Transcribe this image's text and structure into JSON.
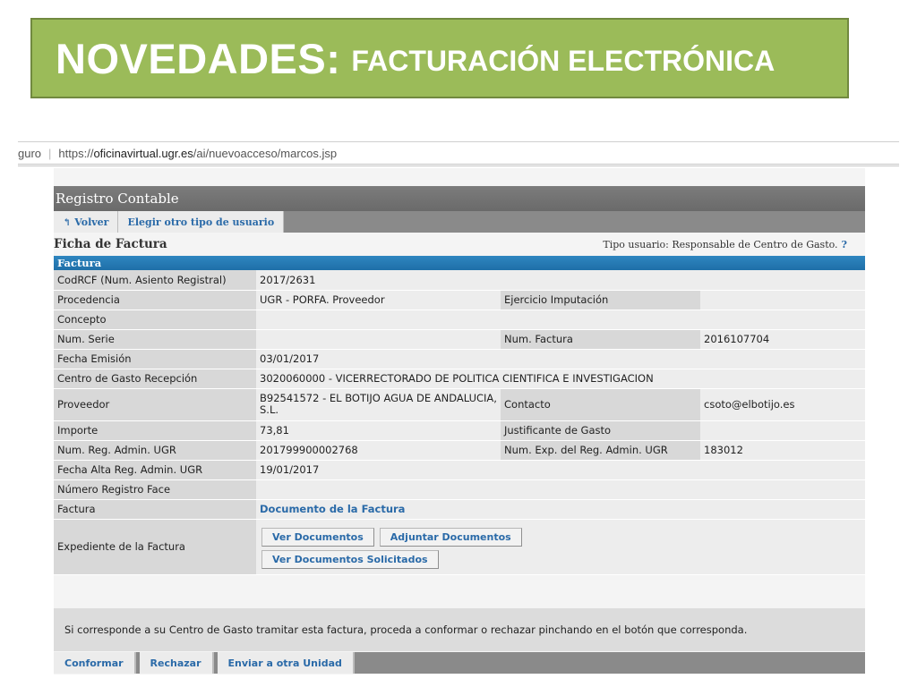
{
  "banner": {
    "title_big": "NOVEDADES:",
    "title_small": "FACTURACIÓN ELECTRÓNICA"
  },
  "browser": {
    "url_prefix": "guro",
    "url_scheme": "https://",
    "url_host": "oficinavirtual.ugr.es",
    "url_path": "/ai/nuevoacceso/marcos.jsp"
  },
  "app": {
    "title": "Registro Contable",
    "tabs": [
      {
        "label": "Volver",
        "icon": "back-arrow-icon"
      },
      {
        "label": "Elegir otro tipo de usuario"
      }
    ],
    "page_title": "Ficha de Factura",
    "user_type": "Tipo usuario: Responsable de Centro de Gasto.",
    "help": "?",
    "section": "Factura"
  },
  "rows": {
    "codrcf": {
      "label": "CodRCF (Num. Asiento Registral)",
      "value": "2017/2631"
    },
    "procedencia": {
      "label": "Procedencia",
      "value": "UGR - PORFA. Proveedor",
      "label2": "Ejercicio Imputación",
      "value2": ""
    },
    "concepto": {
      "label": "Concepto",
      "value": ""
    },
    "serie": {
      "label": "Num. Serie",
      "value": "",
      "label2": "Num. Factura",
      "value2": "2016107704"
    },
    "fecha": {
      "label": "Fecha Emisión",
      "value": "03/01/2017"
    },
    "centro": {
      "label": "Centro de Gasto Recepción",
      "value": "3020060000 - VICERRECTORADO DE POLITICA CIENTIFICA E INVESTIGACION"
    },
    "proveedor": {
      "label": "Proveedor",
      "value": "B92541572 - EL BOTIJO AGUA DE ANDALUCIA, S.L.",
      "label2": "Contacto",
      "value2": "csoto@elbotijo.es"
    },
    "importe": {
      "label": "Importe",
      "value": "73,81",
      "label2": "Justificante de Gasto",
      "value2": ""
    },
    "reg": {
      "label": "Num. Reg. Admin. UGR",
      "value": "201799900002768",
      "label2": "Num. Exp. del Reg. Admin. UGR",
      "value2": "183012"
    },
    "alta": {
      "label": "Fecha Alta Reg. Admin. UGR",
      "value": "19/01/2017"
    },
    "face": {
      "label": "Número Registro Face",
      "value": ""
    },
    "factura": {
      "label": "Factura",
      "link": "Documento de la Factura"
    },
    "expediente": {
      "label": "Expediente de la Factura",
      "buttons": [
        "Ver Documentos",
        "Adjuntar Documentos",
        "Ver Documentos Solicitados"
      ]
    }
  },
  "notice": "Si corresponde a su Centro de Gasto tramitar esta factura, proceda a conformar o rechazar pinchando en el botón que corresponda.",
  "actions": [
    "Conformar",
    "Rechazar",
    "Enviar a otra Unidad"
  ],
  "colors": {
    "banner": "#9bbb59",
    "section_bar": "#1f6fa8",
    "link": "#2a6aa8"
  }
}
